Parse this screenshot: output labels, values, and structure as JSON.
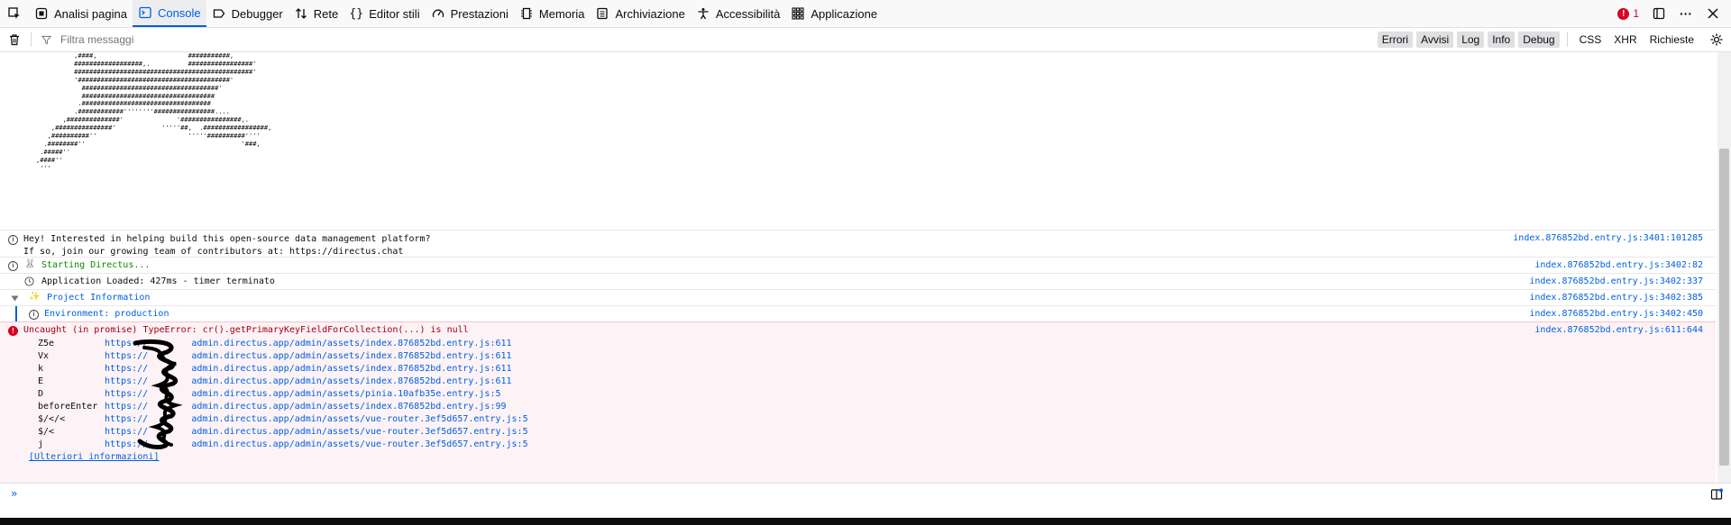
{
  "toolbar": {
    "tabs": [
      {
        "label": "Analisi pagina"
      },
      {
        "label": "Console"
      },
      {
        "label": "Debugger"
      },
      {
        "label": "Rete"
      },
      {
        "label": "Editor stili"
      },
      {
        "label": "Prestazioni"
      },
      {
        "label": "Memoria"
      },
      {
        "label": "Archiviazione"
      },
      {
        "label": "Accessibilità"
      },
      {
        "label": "Applicazione"
      }
    ],
    "error_count": "1"
  },
  "filter": {
    "placeholder": "Filtra messaggi",
    "levels": [
      "Errori",
      "Avvisi",
      "Log",
      "Info",
      "Debug"
    ],
    "types": [
      "CSS",
      "XHR",
      "Richieste"
    ]
  },
  "ascii_art": "          ,####,                        ###########,\n          ##################,.          #################'\n          ###############################################'\n          '########################################'\n            ####################################'\n            ###################################\n           .##################################\n          .############''''''''################....\n       ,##############'              '################,.\n    ,###############'            '''''##,  .#################,\n   ,##########''                        '''''##########''''\n  .########''                                         '###,\n .#####''\n,####''\n '''",
  "messages": [
    {
      "text": "Hey! Interested in helping build this open-source data management platform?\nIf so, join our growing team of contributors at: https://directus.chat",
      "location": "index.876852bd.entry.js:3401:101285"
    },
    {
      "text": "Starting Directus...",
      "location": "index.876852bd.entry.js:3402:82"
    },
    {
      "text": "Application Loaded: 427ms - timer terminato",
      "location": "index.876852bd.entry.js:3402:337"
    },
    {
      "text": "Project Information",
      "location": "index.876852bd.entry.js:3402:385"
    },
    {
      "text": "Environment: production",
      "location": "index.876852bd.entry.js:3402:450"
    }
  ],
  "error": {
    "text": "Uncaught (in promise) TypeError: cr().getPrimaryKeyFieldForCollection(...) is null",
    "location": "index.876852bd.entry.js:611:644",
    "frames": [
      {
        "fn": "Z5e",
        "url": "https://        admin.directus.app/admin/assets/index.876852bd.entry.js:611"
      },
      {
        "fn": "Vx",
        "url": "https://        admin.directus.app/admin/assets/index.876852bd.entry.js:611"
      },
      {
        "fn": "k",
        "url": "https://        admin.directus.app/admin/assets/index.876852bd.entry.js:611"
      },
      {
        "fn": "E",
        "url": "https://        admin.directus.app/admin/assets/index.876852bd.entry.js:611"
      },
      {
        "fn": "D",
        "url": "https://        admin.directus.app/admin/assets/pinia.10afb35e.entry.js:5"
      },
      {
        "fn": "beforeEnter",
        "url": "https://        admin.directus.app/admin/assets/index.876852bd.entry.js:99"
      },
      {
        "fn": "$/</<",
        "url": "https://        admin.directus.app/admin/assets/vue-router.3ef5d657.entry.js:5"
      },
      {
        "fn": "$/<",
        "url": "https://        admin.directus.app/admin/assets/vue-router.3ef5d657.entry.js:5"
      },
      {
        "fn": "j",
        "url": "https://        admin.directus.app/admin/assets/vue-router.3ef5d657.entry.js:5"
      }
    ],
    "more_info": "[Ulteriori informazioni]"
  },
  "prompt_symbol": "»"
}
